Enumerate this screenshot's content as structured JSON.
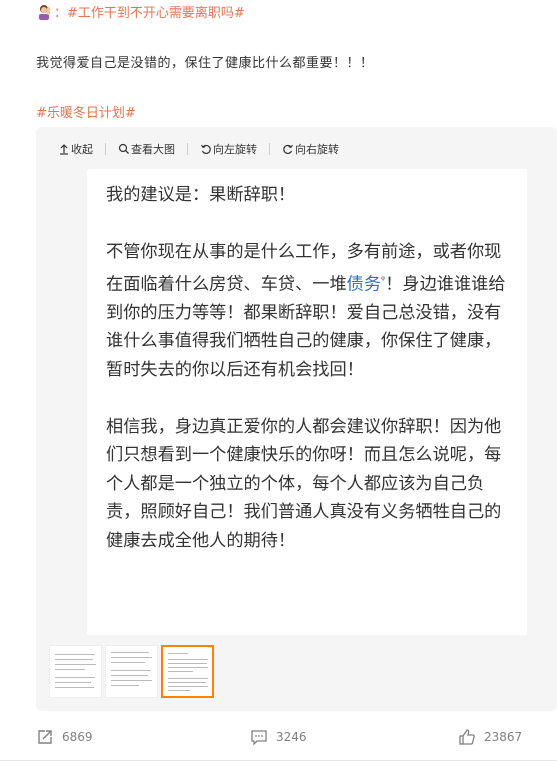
{
  "post": {
    "topic": "#工作干到不开心需要离职吗#",
    "text": "我觉得爱自己是没错的，保住了健康比什么都重要！！！",
    "tag": "#乐暖冬日计划#"
  },
  "toolbar": {
    "collapse": "收起",
    "view_large": "查看大图",
    "rotate_left": "向左旋转",
    "rotate_right": "向右旋转"
  },
  "image_text": {
    "p1": "我的建议是：果断辞职！",
    "p2_a": "不管你现在从事的是什么工作，多有前途，或者你现在面临着什么房贷、车贷、一堆",
    "p2_link": "债务",
    "p2_b": "！身边谁谁谁给到你的压力等等！都果断辞职！爱自己总没错，没有谁什么事值得我们牺牲自己的健康，你保住了健康，暂时失去的你以后还有机会找回！",
    "p3": "相信我，身边真正爱你的人都会建议你辞职！因为他们只想看到一个健康快乐的你呀！而且怎么说呢，每个人都是一个独立的个体，每个人都应该为自己负责，照顾好自己！我们普通人真没有义务牺牲自己的健康去成全他人的期待！"
  },
  "actions": {
    "repost_count": "6869",
    "comment_count": "3246",
    "like_count": "23867"
  },
  "colors": {
    "accent": "#eb7350",
    "link": "#2e6fbf",
    "thumb_active": "#ff8200"
  }
}
